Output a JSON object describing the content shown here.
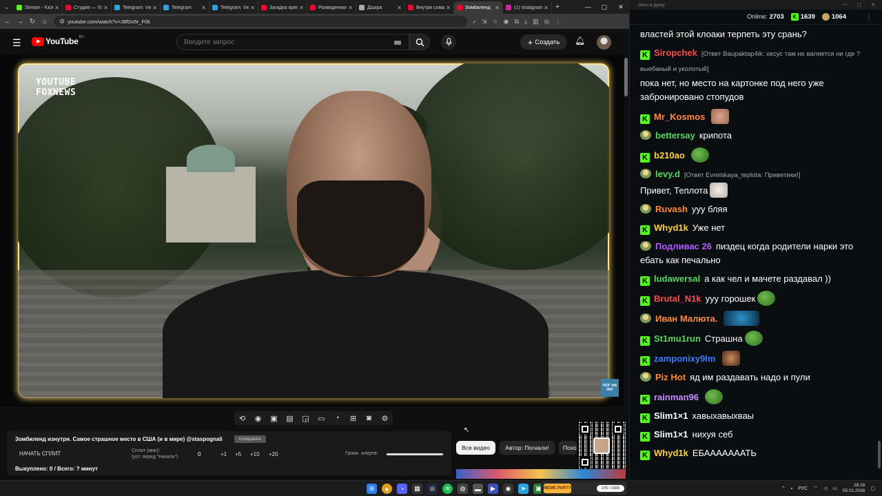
{
  "browser": {
    "tabs": [
      {
        "label": "Stream - Kick",
        "color": "#53fc18",
        "active": false
      },
      {
        "label": "Студия — YouTube",
        "color": "#ff0033",
        "active": false
      },
      {
        "label": "Telegram: View",
        "color": "#2aa3df",
        "active": false
      },
      {
        "label": "Telegram",
        "color": "#2aa3df",
        "active": false
      },
      {
        "label": "Telegram: View",
        "color": "#2aa3df",
        "active": false
      },
      {
        "label": "Загадка арест",
        "color": "#ff0033",
        "active": false
      },
      {
        "label": "Разведенная",
        "color": "#ff0033",
        "active": false
      },
      {
        "label": "Дiшiра",
        "color": "#aaaaaa",
        "active": false
      },
      {
        "label": "Внутри сомал",
        "color": "#ff0033",
        "active": false
      },
      {
        "label": "Зомбиленд",
        "color": "#ff0033",
        "active": true
      },
      {
        "label": "(1) Instagram",
        "color": "#d6249f",
        "active": false
      }
    ],
    "url": "youtube.com/watch?v=J8fDo5r_F0k"
  },
  "youtube": {
    "logo_text": "YouTube",
    "region": "RU",
    "search_placeholder": "Введите запрос",
    "create_label": "Создать",
    "create_plus": "+",
    "watermark_line1": "YOUTUBE",
    "watermark_line2": "FOXNEWS",
    "corner_logo": "ПОГ НА ЛИ!"
  },
  "info_panel": {
    "title": "Зомбиленд изнутри. Самое страшное место в США (и в мире) @staspognali",
    "copy_label": "Копировать",
    "start_split": "НАЧАТЬ СПЛИТ",
    "split_label": "Сплит (мин):",
    "split_hint": "(уст. перед \"Начать\")",
    "split_value": "0",
    "increments": [
      "+1",
      "+5",
      "+10",
      "+20"
    ],
    "alert_volume_label": "Громк. алерта:",
    "alert_volume_level": 1.0,
    "paid_line": "Выкуплено: 0 / Всего: ? минут"
  },
  "chips": [
    "Все видео",
    "Автор: Погнали!",
    "Похо"
  ],
  "chat": {
    "window_title": "Окно в дурку",
    "online_label": "Online:",
    "online_count": "2703",
    "kick_count": "1639",
    "points_count": "1064",
    "messages": [
      {
        "badge": "none",
        "user": "",
        "color": "#ffffff",
        "reply": "",
        "text": "властей этой клоаки терпеть эту срань?",
        "emote": ""
      },
      {
        "badge": "k",
        "user": "Siropchek",
        "color": "#ff4b4b",
        "reply": "[Ответ Baupaktap4ik: хесус там не валяется ни где ? выебаный и уколотый]",
        "text": "пока нет, но место на картонке под него уже забронировано стопудов",
        "emote": ""
      },
      {
        "badge": "k",
        "user": "Mr_Kosmos",
        "color": "#ff8b3d",
        "reply": "",
        "text": "",
        "emote": "e-face"
      },
      {
        "badge": "p",
        "user": "bettersay",
        "color": "#58d65e",
        "reply": "",
        "text": "крипота",
        "emote": ""
      },
      {
        "badge": "k",
        "user": "b210ao",
        "color": "#ffd23f",
        "reply": "",
        "text": "",
        "emote": "e-pepe"
      },
      {
        "badge": "p",
        "user": "levy.d",
        "color": "#58d65e",
        "reply": "[Ответ Evreiskaya_teplota: Приветики!]",
        "text": "Привет, Теплота",
        "emote": "e-cat"
      },
      {
        "badge": "p",
        "user": "Ruvash",
        "color": "#ff8b3d",
        "reply": "",
        "text": "ууу бляя",
        "emote": ""
      },
      {
        "badge": "k",
        "user": "Whyd1k",
        "color": "#ffd23f",
        "reply": "",
        "text": "Уже нет",
        "emote": ""
      },
      {
        "badge": "p",
        "user": "Подливас 26",
        "color": "#b25cff",
        "reply": "",
        "text": "пиздец когда родители нарки это ебать как печально",
        "emote": ""
      },
      {
        "badge": "k",
        "user": "ludawersal",
        "color": "#58d65e",
        "reply": "",
        "text": "а как чел и мачете раздавал ))",
        "emote": ""
      },
      {
        "badge": "k",
        "user": "Brutal_N1k",
        "color": "#ff4b4b",
        "reply": "",
        "text": "ууу горошек",
        "emote": "e-pepe"
      },
      {
        "badge": "p",
        "user": "Иван Малюта.",
        "color": "#ff8b3d",
        "reply": "",
        "text": "",
        "emote": "e-blue"
      },
      {
        "badge": "k",
        "user": "St1mu1run",
        "color": "#58d65e",
        "reply": "",
        "text": "Страшна",
        "emote": "e-pepe"
      },
      {
        "badge": "k",
        "user": "zamponixy9lm",
        "color": "#3d7bff",
        "reply": "",
        "text": "",
        "emote": "e-man"
      },
      {
        "badge": "p",
        "user": "Piz Hot",
        "color": "#ff8b3d",
        "reply": "",
        "text": "яд им раздавать надо и пули",
        "emote": ""
      },
      {
        "badge": "k",
        "user": "rainman96",
        "color": "#c78bff",
        "reply": "",
        "text": "",
        "emote": "e-pepe"
      },
      {
        "badge": "k",
        "user": "Slim1×1",
        "color": "#ffffff",
        "reply": "",
        "text": "хавыхавыхваы",
        "emote": ""
      },
      {
        "badge": "k",
        "user": "Slim1×1",
        "color": "#ffffff",
        "reply": "",
        "text": "нихуя себ",
        "emote": ""
      },
      {
        "badge": "k",
        "user": "Whyd1k",
        "color": "#ffd23f",
        "reply": "",
        "text": "ЕБАААААААТЬ",
        "emote": ""
      }
    ]
  },
  "taskbar": {
    "app_label": "MEME PARTY",
    "app_counter": "276 / 1500",
    "lang": "РУС",
    "time": "18:18",
    "date": "05.01.2026"
  }
}
